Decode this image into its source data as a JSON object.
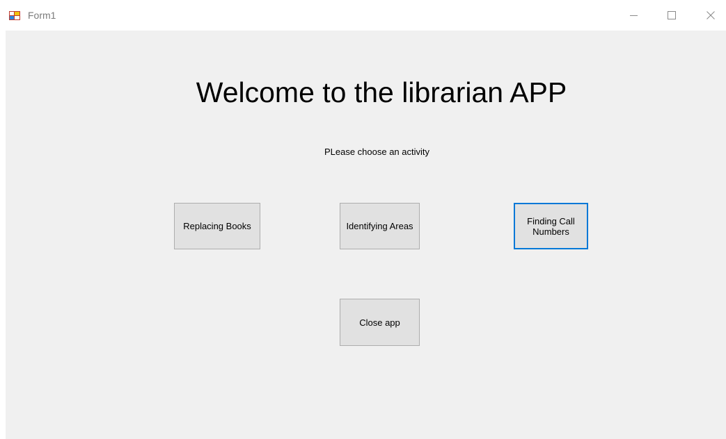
{
  "window": {
    "title": "Form1"
  },
  "main": {
    "heading": "Welcome to the librarian APP",
    "subtitle": "PLease choose an activity"
  },
  "buttons": {
    "replacing_books": "Replacing Books",
    "identifying_areas": "Identifying Areas",
    "finding_call_numbers": "Finding Call Numbers",
    "close_app": "Close app"
  },
  "icons": {
    "app": "windows-form-icon",
    "minimize": "minimize-icon",
    "maximize": "maximize-icon",
    "close": "close-icon"
  },
  "colors": {
    "client_background": "#f0f0f0",
    "button_background": "#e1e1e1",
    "button_border": "#adadad",
    "focus_border": "#0078d7"
  },
  "state": {
    "focused_button": "finding_call_numbers"
  }
}
